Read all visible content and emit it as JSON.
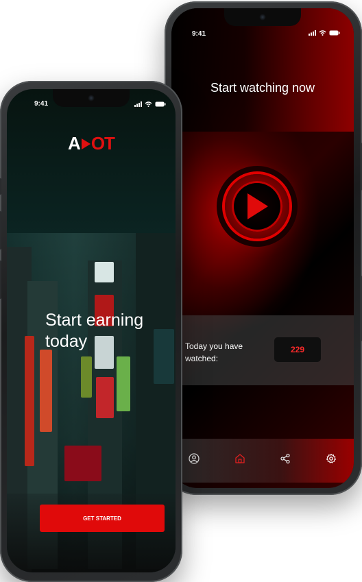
{
  "back_phone": {
    "status_time": "9:41",
    "title": "Start watching now",
    "watch_label": "Today you have watched:",
    "watch_count": "229",
    "nav_items": [
      "profile-icon",
      "home-icon",
      "share-icon",
      "settings-icon"
    ],
    "colors": {
      "accent": "#e00a0a",
      "count_text": "#ff2a2a"
    }
  },
  "front_phone": {
    "status_time": "9:41",
    "logo_white": "A",
    "logo_red": "OT",
    "heading": "Start earning today",
    "cta_label": "GET STARTED",
    "colors": {
      "button": "#e00a0a"
    }
  }
}
